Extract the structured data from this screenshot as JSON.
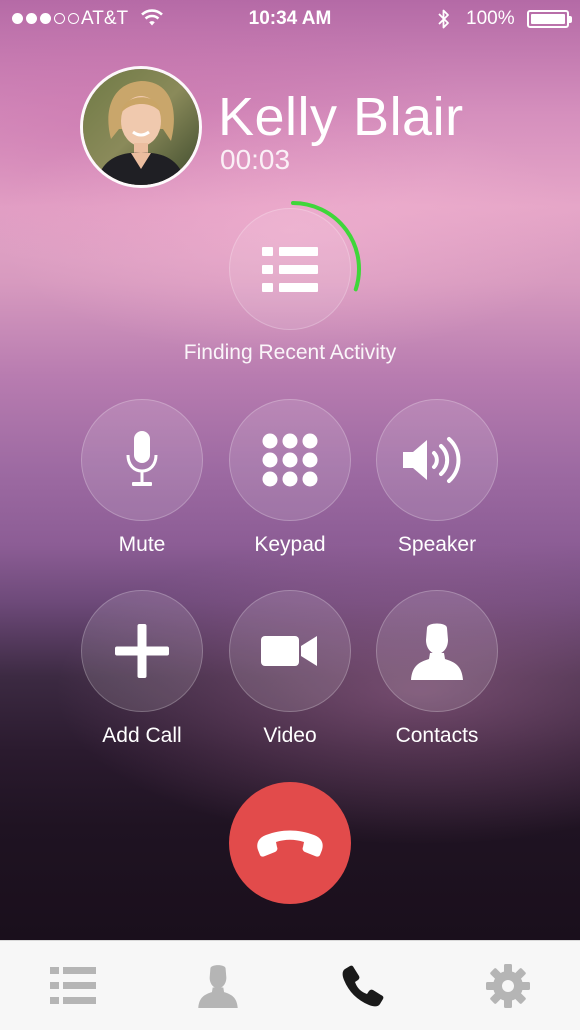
{
  "status_bar": {
    "carrier": "AT&T",
    "time": "10:34 AM",
    "battery": "100%",
    "signal_dots_filled": 3,
    "signal_dots_total": 5
  },
  "caller": {
    "name": "Kelly Blair",
    "duration": "00:03"
  },
  "activity": {
    "label": "Finding Recent Activity",
    "progress": 0.3,
    "progress_color": "#3fd63a"
  },
  "controls": [
    {
      "label": "Mute",
      "icon": "microphone-icon"
    },
    {
      "label": "Keypad",
      "icon": "keypad-icon"
    },
    {
      "label": "Speaker",
      "icon": "speaker-icon"
    },
    {
      "label": "Add Call",
      "icon": "plus-icon"
    },
    {
      "label": "Video",
      "icon": "video-camera-icon"
    },
    {
      "label": "Contacts",
      "icon": "person-icon"
    }
  ],
  "end_call": {
    "icon": "hang-up-icon",
    "color": "#e24b4b"
  },
  "tab_bar": {
    "tabs": [
      {
        "icon": "list-icon",
        "active": false
      },
      {
        "icon": "person-icon",
        "active": false
      },
      {
        "icon": "phone-icon",
        "active": true
      },
      {
        "icon": "gear-icon",
        "active": false
      }
    ],
    "active_color": "#1a1a1a",
    "inactive_color": "#b5b5b5"
  }
}
